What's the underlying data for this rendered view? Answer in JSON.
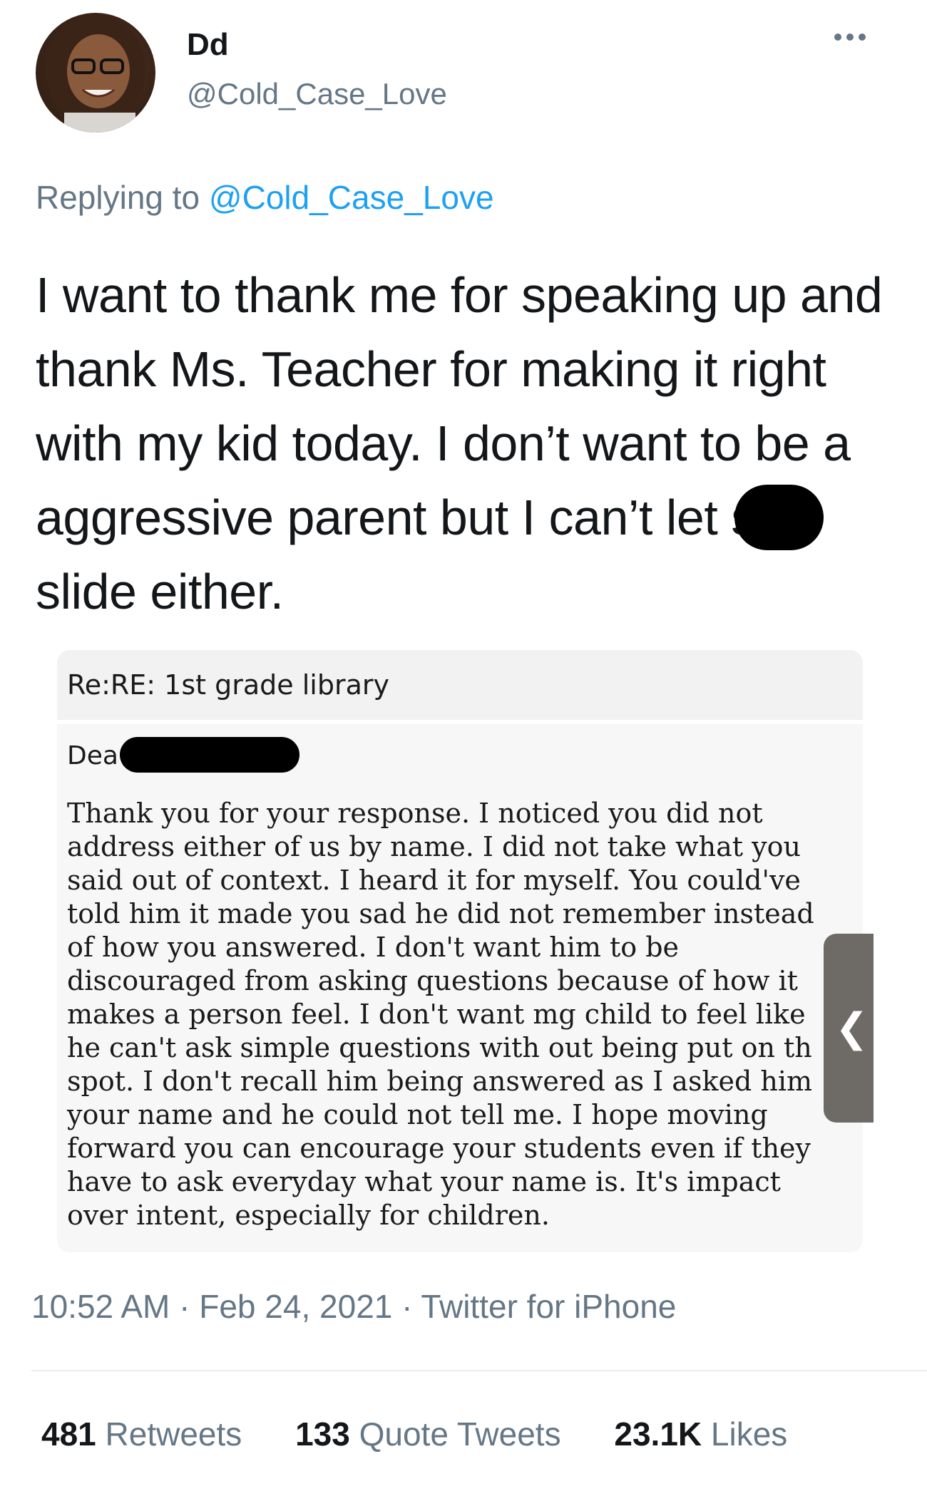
{
  "author": {
    "name": "Dd",
    "handle": "@Cold_Case_Love"
  },
  "reply": {
    "prefix": "Replying to",
    "mention": "@Cold_Case_Love"
  },
  "tweet": {
    "part1": "I want to thank me for speaking up and thank Ms. Teacher for making it right with my kid today. I don’t want to be a aggressive parent but I can’t let s",
    "part2": "slide either."
  },
  "email": {
    "subject": "Re:RE: 1st grade library",
    "greeting": "Dea",
    "body": "Thank you for your response. I noticed you did not\naddress either of us by name. I did not take what you\nsaid out of context. I heard it for myself. You could've\ntold him it made you sad he did not remember instead\nof how you answered. I don't want him to be\ndiscouraged from asking questions because of how it\nmakes a person feel. I don't want mg child to feel like\nhe can't ask simple questions with out being put on th\nspot. I don't recall him being answered as I asked him\nyour name and he could not tell me. I hope moving\nforward you can encourage your students even if they\nhave to ask everyday what your name is. It's impact\nover intent, especially for children."
  },
  "meta": {
    "time": "10:52 AM",
    "date": "Feb 24, 2021",
    "source": "Twitter for iPhone"
  },
  "stats": {
    "retweets_count": "481",
    "retweets_label": "Retweets",
    "quotes_count": "133",
    "quotes_label": "Quote Tweets",
    "likes_count": "23.1K",
    "likes_label": "Likes"
  },
  "icons": {
    "more": "more-icon",
    "side_handle": "chevron-left-icon"
  },
  "colors": {
    "link": "#1da1f2",
    "muted": "#657786",
    "text": "#14171a"
  }
}
